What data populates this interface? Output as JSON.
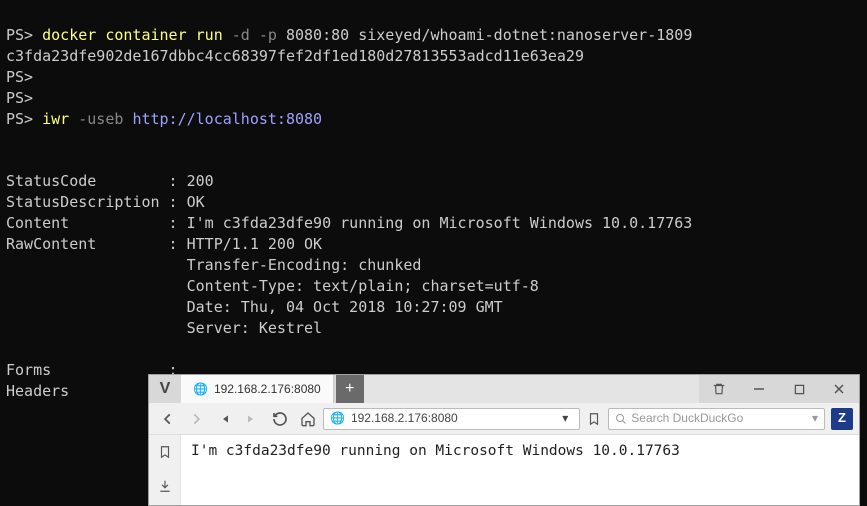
{
  "terminal": {
    "lines": [
      {
        "type": "cmd",
        "prompt": "PS>",
        "cmd": "docker",
        "args": "container run",
        "flags": "-d -p",
        "rest": "8080:80 sixeyed/whoami-dotnet:nanoserver-1809"
      },
      {
        "type": "out",
        "text": "c3fda23dfe902de167dbbc4cc68397fef2df1ed180d27813553adcd11e63ea29"
      },
      {
        "type": "prompt",
        "prompt": "PS>"
      },
      {
        "type": "prompt",
        "prompt": "PS>"
      },
      {
        "type": "cmd2",
        "prompt": "PS>",
        "cmd": "iwr",
        "flag": "-useb",
        "url": "http://localhost:8080"
      }
    ],
    "result": {
      "StatusCode": "200",
      "StatusDescription": "OK",
      "Content": "I'm c3fda23dfe90 running on Microsoft Windows 10.0.17763",
      "RawContent_lines": [
        "HTTP/1.1 200 OK",
        "Transfer-Encoding: chunked",
        "Content-Type: text/plain; charset=utf-8",
        "Date: Thu, 04 Oct 2018 10:27:09 GMT",
        "Server: Kestrel"
      ],
      "Forms": "",
      "Headers": ""
    }
  },
  "browser": {
    "tab_title": "192.168.2.176:8080",
    "newtab_label": "+",
    "url": "192.168.2.176:8080",
    "search_placeholder": "Search DuckDuckGo",
    "z_label": "Z",
    "body": "I'm c3fda23dfe90 running on Microsoft Windows 10.0.17763"
  }
}
